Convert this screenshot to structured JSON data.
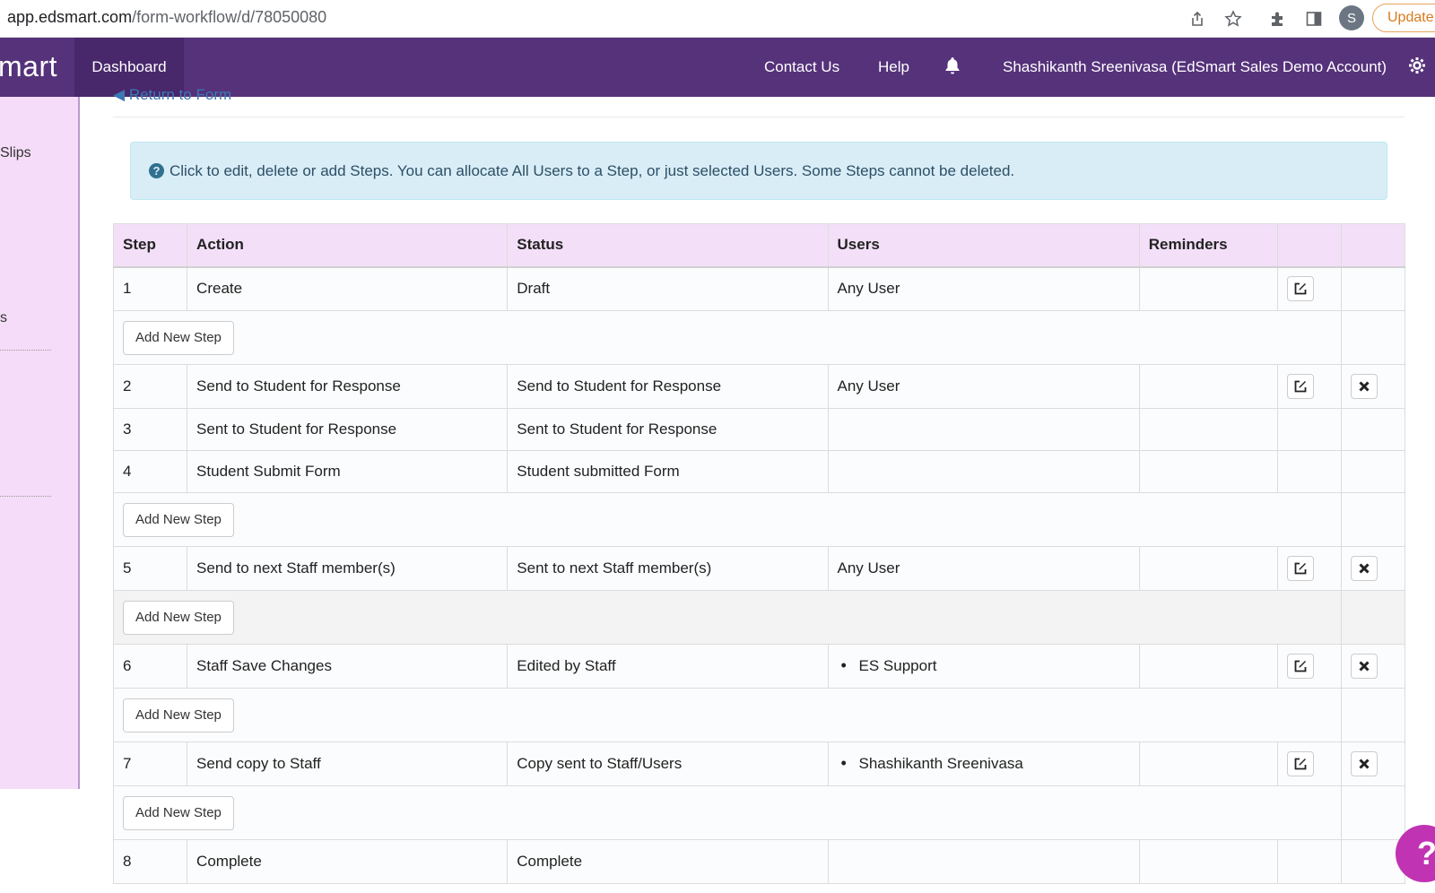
{
  "browser": {
    "url_host": "app.edsmart.com",
    "url_path": "/form-workflow/d/78050080",
    "profile_initial": "S",
    "update_label": "Update"
  },
  "navbar": {
    "brand": "mart",
    "dashboard": "Dashboard",
    "contact": "Contact Us",
    "help": "Help",
    "user": "Shashikanth Sreenivasa (EdSmart Sales Demo Account)"
  },
  "sidebar": {
    "item1": "Slips",
    "item2": "s"
  },
  "return_link": "Return to Form",
  "alert": {
    "icon": "?",
    "text": "Click to edit, delete or add Steps. You can allocate All Users to a Step, or just selected Users. Some Steps cannot be deleted."
  },
  "table": {
    "headers": {
      "step": "Step",
      "action": "Action",
      "status": "Status",
      "users": "Users",
      "reminders": "Reminders"
    },
    "add_label": "Add New Step",
    "rows": [
      {
        "step": "1",
        "action": "Create",
        "status": "Draft",
        "users": "Any User"
      },
      {
        "step": "2",
        "action": "Send to Student for Response",
        "status": "Send to Student for Response",
        "users": "Any User"
      },
      {
        "step": "3",
        "action": "Sent to Student for Response",
        "status": "Sent to Student for Response",
        "users": ""
      },
      {
        "step": "4",
        "action": "Student Submit Form",
        "status": "Student submitted Form",
        "users": ""
      },
      {
        "step": "5",
        "action": "Send to next Staff member(s)",
        "status": "Sent to next Staff member(s)",
        "users": "Any User"
      },
      {
        "step": "6",
        "action": "Staff Save Changes",
        "status": "Edited by Staff",
        "users": "ES Support"
      },
      {
        "step": "7",
        "action": "Send copy to Staff",
        "status": "Copy sent to Staff/Users",
        "users": "Shashikanth Sreenivasa"
      },
      {
        "step": "8",
        "action": "Complete",
        "status": "Complete",
        "users": ""
      }
    ]
  },
  "help_bubble": "?"
}
